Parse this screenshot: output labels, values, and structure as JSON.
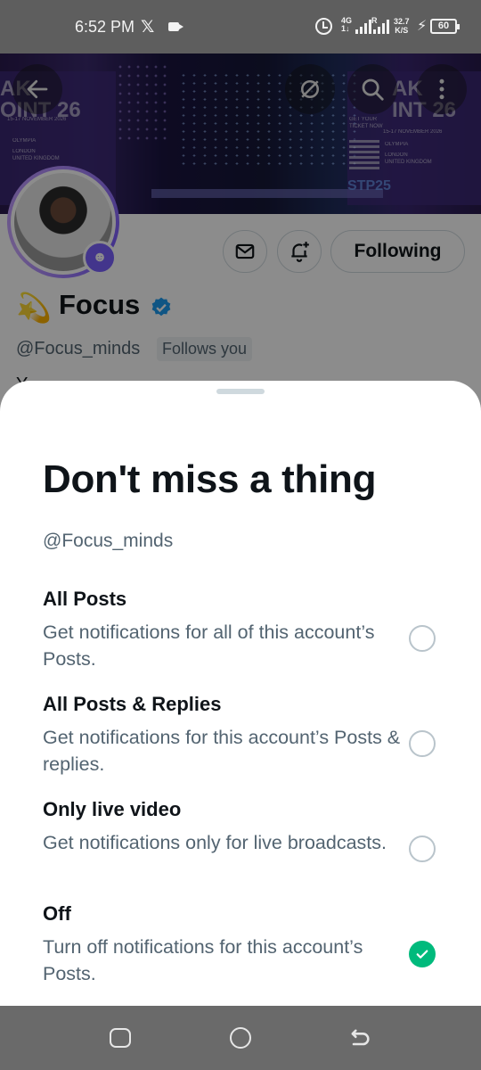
{
  "status_bar": {
    "time": "6:52 PM",
    "app_icon": "x-logo",
    "x_glyph": "𝕏",
    "network": "4G",
    "net_sub": "1↓",
    "sim2": "R",
    "speed_value": "32.7",
    "speed_unit": "K/S",
    "battery": "60"
  },
  "banner": {
    "text_left": "AK\nOINT 26",
    "text_right": "AK\nINT 26",
    "event_dates": "15-17 NOVEMBER 2026",
    "venue": "OLYMPIA",
    "city": "LONDON\nUNITED KINGDOM",
    "ticket": "GET YOUR\nTICKET NOW",
    "stage_label": "STP25"
  },
  "header_buttons": {
    "back": "back-arrow-icon",
    "hide": "eye-off-icon",
    "search": "search-icon",
    "more": "more-vertical-icon"
  },
  "profile": {
    "emoji": "💫",
    "name": "Focus",
    "handle": "@Focus_minds",
    "follows_you": "Follows you",
    "bio_peek": "Y",
    "following_label": "Following",
    "verified_color": "#1d9bf0"
  },
  "sheet": {
    "title": "Don't miss a thing",
    "handle": "@Focus_minds",
    "options": [
      {
        "title": "All Posts",
        "description": "Get notifications for all of this account’s Posts.",
        "selected": false
      },
      {
        "title": "All Posts & Replies",
        "description": "Get notifications for this account’s Posts & replies.",
        "selected": false
      },
      {
        "title": "Only live video",
        "description": "Get notifications only for live broadcasts.",
        "selected": false
      },
      {
        "title": "Off",
        "description": "Turn off notifications for this account’s Posts.",
        "selected": true
      }
    ],
    "selected_color": "#00ba7c"
  },
  "nav_bar": {
    "recents": "recents-icon",
    "home": "home-icon",
    "back": "back-icon"
  }
}
